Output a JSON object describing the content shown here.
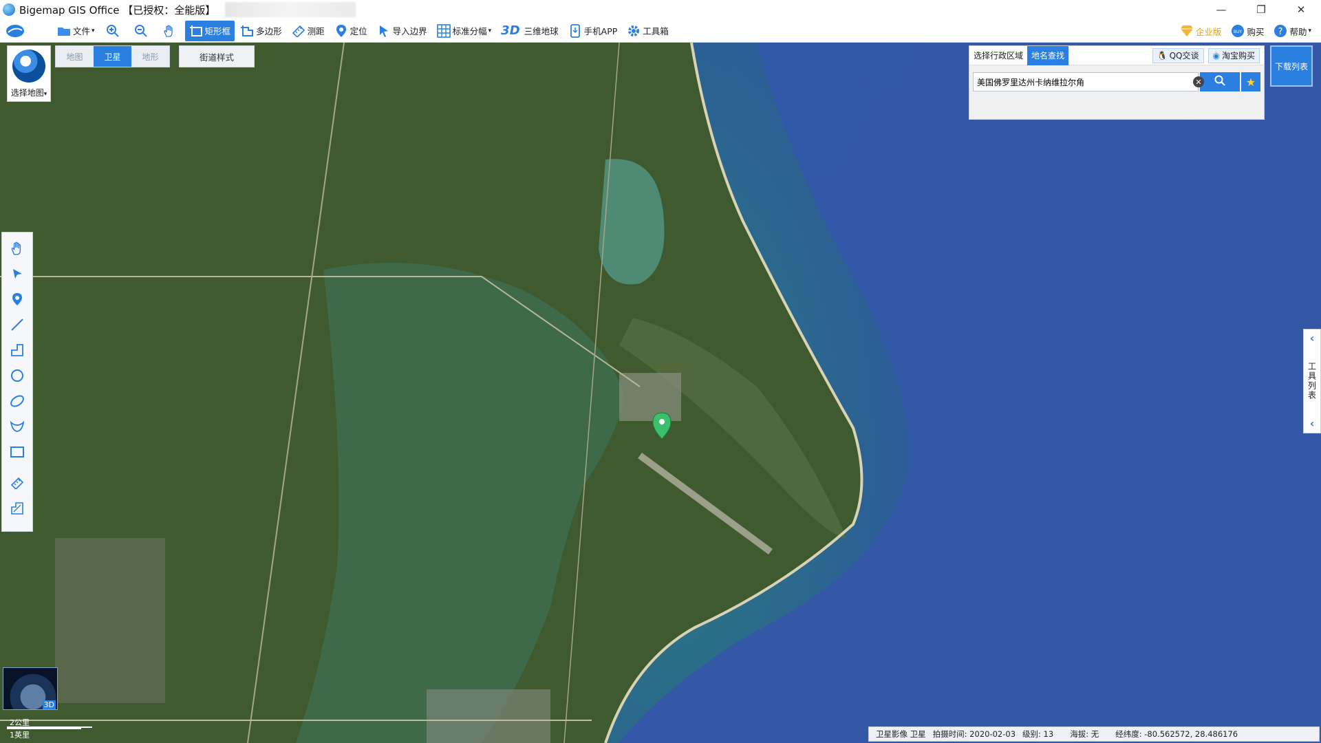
{
  "window": {
    "title": "Bigemap GIS Office 【已授权：全能版】",
    "controls": {
      "minimize": "—",
      "restore": "❐",
      "close": "✕"
    }
  },
  "toolbar": {
    "file": "文件",
    "zoom_in": "",
    "zoom_out": "",
    "pan": "",
    "rect_select": "矩形框",
    "polygon": "多边形",
    "measure": "测距",
    "locate": "定位",
    "import_boundary": "导入边界",
    "std_sheet": "标准分幅",
    "three_d_label": "3D",
    "globe3d": "三维地球",
    "mobile_app": "手机APP",
    "toolbox": "工具箱",
    "enterprise": "企业版",
    "buy": "购买",
    "help": "帮助"
  },
  "map_controls": {
    "select_map": "选择地图",
    "tabs": [
      "地图",
      "卫星",
      "地形"
    ],
    "active_tab": "卫星",
    "street_style": "街道样式"
  },
  "search_panel": {
    "tab_region": "选择行政区域",
    "tab_place": "地名查找",
    "qq_chat": "QQ交谈",
    "taobao_buy": "淘宝购买",
    "query": "美国佛罗里达州卡纳维拉尔角"
  },
  "download_list": "下载列表",
  "right_toollist": "工具列表",
  "globe_3d_label": "3D",
  "scale": {
    "km": "2公里",
    "mi": "1英里"
  },
  "status": {
    "source": "卫星影像 卫星",
    "capture_date": "拍摄时间: 2020-02-03",
    "level": "级别:  13",
    "altitude": "海拔: 无",
    "coordinates": "经纬度:    -80.562572, 28.486176"
  },
  "colors": {
    "accent": "#2b7fe0",
    "ocean_deep": "#2a4fa0",
    "ocean_shallow": "#2f7f8c",
    "land": "#3e5a2c",
    "lagoon": "#3d6246",
    "marker": "#3cbf6a"
  }
}
